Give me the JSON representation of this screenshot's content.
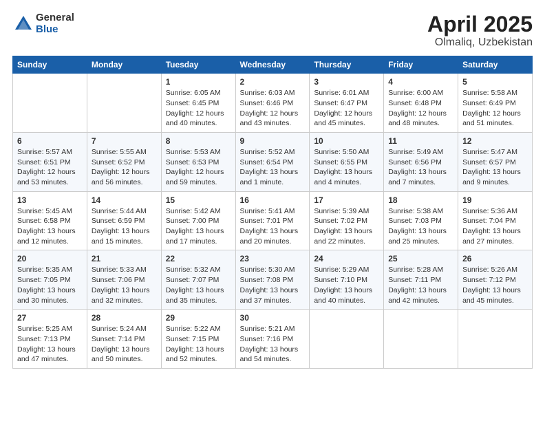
{
  "logo": {
    "general": "General",
    "blue": "Blue"
  },
  "title": "April 2025",
  "subtitle": "Olmaliq, Uzbekistan",
  "days_header": [
    "Sunday",
    "Monday",
    "Tuesday",
    "Wednesday",
    "Thursday",
    "Friday",
    "Saturday"
  ],
  "weeks": [
    [
      {
        "day": "",
        "sunrise": "",
        "sunset": "",
        "daylight": ""
      },
      {
        "day": "",
        "sunrise": "",
        "sunset": "",
        "daylight": ""
      },
      {
        "day": "1",
        "sunrise": "Sunrise: 6:05 AM",
        "sunset": "Sunset: 6:45 PM",
        "daylight": "Daylight: 12 hours and 40 minutes."
      },
      {
        "day": "2",
        "sunrise": "Sunrise: 6:03 AM",
        "sunset": "Sunset: 6:46 PM",
        "daylight": "Daylight: 12 hours and 43 minutes."
      },
      {
        "day": "3",
        "sunrise": "Sunrise: 6:01 AM",
        "sunset": "Sunset: 6:47 PM",
        "daylight": "Daylight: 12 hours and 45 minutes."
      },
      {
        "day": "4",
        "sunrise": "Sunrise: 6:00 AM",
        "sunset": "Sunset: 6:48 PM",
        "daylight": "Daylight: 12 hours and 48 minutes."
      },
      {
        "day": "5",
        "sunrise": "Sunrise: 5:58 AM",
        "sunset": "Sunset: 6:49 PM",
        "daylight": "Daylight: 12 hours and 51 minutes."
      }
    ],
    [
      {
        "day": "6",
        "sunrise": "Sunrise: 5:57 AM",
        "sunset": "Sunset: 6:51 PM",
        "daylight": "Daylight: 12 hours and 53 minutes."
      },
      {
        "day": "7",
        "sunrise": "Sunrise: 5:55 AM",
        "sunset": "Sunset: 6:52 PM",
        "daylight": "Daylight: 12 hours and 56 minutes."
      },
      {
        "day": "8",
        "sunrise": "Sunrise: 5:53 AM",
        "sunset": "Sunset: 6:53 PM",
        "daylight": "Daylight: 12 hours and 59 minutes."
      },
      {
        "day": "9",
        "sunrise": "Sunrise: 5:52 AM",
        "sunset": "Sunset: 6:54 PM",
        "daylight": "Daylight: 13 hours and 1 minute."
      },
      {
        "day": "10",
        "sunrise": "Sunrise: 5:50 AM",
        "sunset": "Sunset: 6:55 PM",
        "daylight": "Daylight: 13 hours and 4 minutes."
      },
      {
        "day": "11",
        "sunrise": "Sunrise: 5:49 AM",
        "sunset": "Sunset: 6:56 PM",
        "daylight": "Daylight: 13 hours and 7 minutes."
      },
      {
        "day": "12",
        "sunrise": "Sunrise: 5:47 AM",
        "sunset": "Sunset: 6:57 PM",
        "daylight": "Daylight: 13 hours and 9 minutes."
      }
    ],
    [
      {
        "day": "13",
        "sunrise": "Sunrise: 5:45 AM",
        "sunset": "Sunset: 6:58 PM",
        "daylight": "Daylight: 13 hours and 12 minutes."
      },
      {
        "day": "14",
        "sunrise": "Sunrise: 5:44 AM",
        "sunset": "Sunset: 6:59 PM",
        "daylight": "Daylight: 13 hours and 15 minutes."
      },
      {
        "day": "15",
        "sunrise": "Sunrise: 5:42 AM",
        "sunset": "Sunset: 7:00 PM",
        "daylight": "Daylight: 13 hours and 17 minutes."
      },
      {
        "day": "16",
        "sunrise": "Sunrise: 5:41 AM",
        "sunset": "Sunset: 7:01 PM",
        "daylight": "Daylight: 13 hours and 20 minutes."
      },
      {
        "day": "17",
        "sunrise": "Sunrise: 5:39 AM",
        "sunset": "Sunset: 7:02 PM",
        "daylight": "Daylight: 13 hours and 22 minutes."
      },
      {
        "day": "18",
        "sunrise": "Sunrise: 5:38 AM",
        "sunset": "Sunset: 7:03 PM",
        "daylight": "Daylight: 13 hours and 25 minutes."
      },
      {
        "day": "19",
        "sunrise": "Sunrise: 5:36 AM",
        "sunset": "Sunset: 7:04 PM",
        "daylight": "Daylight: 13 hours and 27 minutes."
      }
    ],
    [
      {
        "day": "20",
        "sunrise": "Sunrise: 5:35 AM",
        "sunset": "Sunset: 7:05 PM",
        "daylight": "Daylight: 13 hours and 30 minutes."
      },
      {
        "day": "21",
        "sunrise": "Sunrise: 5:33 AM",
        "sunset": "Sunset: 7:06 PM",
        "daylight": "Daylight: 13 hours and 32 minutes."
      },
      {
        "day": "22",
        "sunrise": "Sunrise: 5:32 AM",
        "sunset": "Sunset: 7:07 PM",
        "daylight": "Daylight: 13 hours and 35 minutes."
      },
      {
        "day": "23",
        "sunrise": "Sunrise: 5:30 AM",
        "sunset": "Sunset: 7:08 PM",
        "daylight": "Daylight: 13 hours and 37 minutes."
      },
      {
        "day": "24",
        "sunrise": "Sunrise: 5:29 AM",
        "sunset": "Sunset: 7:10 PM",
        "daylight": "Daylight: 13 hours and 40 minutes."
      },
      {
        "day": "25",
        "sunrise": "Sunrise: 5:28 AM",
        "sunset": "Sunset: 7:11 PM",
        "daylight": "Daylight: 13 hours and 42 minutes."
      },
      {
        "day": "26",
        "sunrise": "Sunrise: 5:26 AM",
        "sunset": "Sunset: 7:12 PM",
        "daylight": "Daylight: 13 hours and 45 minutes."
      }
    ],
    [
      {
        "day": "27",
        "sunrise": "Sunrise: 5:25 AM",
        "sunset": "Sunset: 7:13 PM",
        "daylight": "Daylight: 13 hours and 47 minutes."
      },
      {
        "day": "28",
        "sunrise": "Sunrise: 5:24 AM",
        "sunset": "Sunset: 7:14 PM",
        "daylight": "Daylight: 13 hours and 50 minutes."
      },
      {
        "day": "29",
        "sunrise": "Sunrise: 5:22 AM",
        "sunset": "Sunset: 7:15 PM",
        "daylight": "Daylight: 13 hours and 52 minutes."
      },
      {
        "day": "30",
        "sunrise": "Sunrise: 5:21 AM",
        "sunset": "Sunset: 7:16 PM",
        "daylight": "Daylight: 13 hours and 54 minutes."
      },
      {
        "day": "",
        "sunrise": "",
        "sunset": "",
        "daylight": ""
      },
      {
        "day": "",
        "sunrise": "",
        "sunset": "",
        "daylight": ""
      },
      {
        "day": "",
        "sunrise": "",
        "sunset": "",
        "daylight": ""
      }
    ]
  ]
}
